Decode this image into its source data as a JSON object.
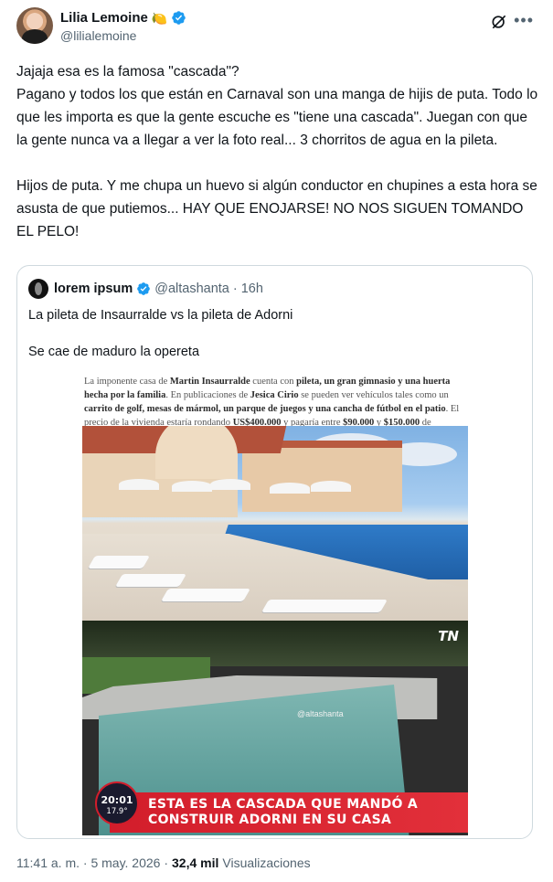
{
  "author": {
    "name": "Lilia Lemoine",
    "emoji": "🍋",
    "handle": "@lilialemoine"
  },
  "tweet": {
    "text": "Jajaja esa es la famosa \"cascada\"?\nPagano y todos los que están en Carnaval son una manga de hijis de puta. Todo lo que les importa es que la gente escuche es \"tiene una cascada\". Juegan con que la gente nunca va a llegar a ver la foto real... 3 chorritos de agua en la pileta.\n\nHijos de puta. Y me chupa un huevo si algún conductor en chupines a esta hora se asusta de que putiemos... HAY QUE ENOJARSE! NO NOS SIGUEN TOMANDO EL PELO!"
  },
  "quote": {
    "name": "lorem ipsum",
    "handle": "@altashanta",
    "separator": "·",
    "time": "16h",
    "text": "La pileta de Insaurralde vs la pileta de Adorni\n\nSe cae de maduro la opereta",
    "article": {
      "p1": "La imponente casa de ",
      "b1": "Martin Insaurralde",
      "p2": " cuenta con ",
      "b2": "pileta, un gran gimnasio y una huerta hecha por la familia",
      "p3": ". En publicaciones de ",
      "b3": "Jesica Cirio",
      "p4": " se pueden ver vehículos tales como un ",
      "b4": "carrito de golf, mesas de mármol, un parque de juegos y una cancha de fútbol en el patio",
      "p5": ". El precio de la vivienda estaría rondando ",
      "b5": "US$400.000",
      "p6": " y pagaría entre ",
      "b6": "$90.000",
      "p7": " y ",
      "b7": "$150.000",
      "p8": " de expensas por mes."
    },
    "video": {
      "channel_logo": "TN",
      "watermark": "@altashanta",
      "banner_line1": "ESTA ES LA CASCADA QUE MANDÓ A",
      "banner_line2": "CONSTRUIR ADORNI EN SU CASA",
      "clock_time": "20:01",
      "clock_temp": "17.9°"
    }
  },
  "footer": {
    "time": "11:41 a. m. · 5 may. 2026 ·",
    "views_count": "32,4 mil",
    "views_label": "Visualizaciones"
  },
  "colors": {
    "verified": "#1d9bf0",
    "secondary_text": "#536471",
    "border": "#cfd9de",
    "banner_red": "#d21d2b"
  },
  "icons": [
    "verified-badge-icon",
    "grok-icon",
    "more-icon"
  ]
}
